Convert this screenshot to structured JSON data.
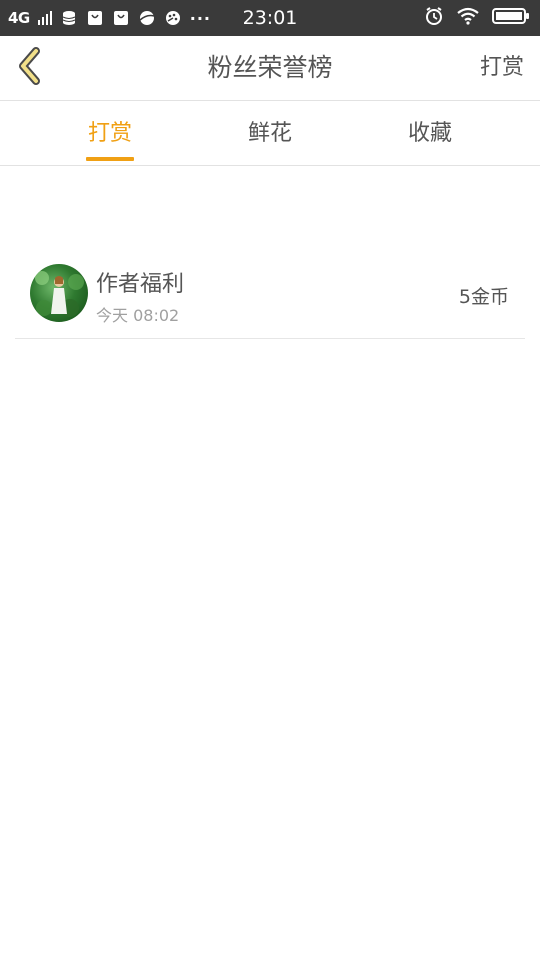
{
  "status_bar": {
    "network": "4G",
    "time": "23:01",
    "more": "···"
  },
  "header": {
    "title": "粉丝荣誉榜",
    "action_label": "打赏",
    "back_icon": "chevron-left-icon"
  },
  "tabs": [
    {
      "label": "打赏",
      "active": true
    },
    {
      "label": "鲜花",
      "active": false
    },
    {
      "label": "收藏",
      "active": false
    }
  ],
  "colors": {
    "accent": "#f0a014",
    "text": "#555555",
    "subtext": "#a0a0a0",
    "status_bar": "#3a3a3a"
  },
  "list": [
    {
      "name": "作者福利",
      "time": "今天 08:02",
      "amount": "5金币"
    }
  ]
}
